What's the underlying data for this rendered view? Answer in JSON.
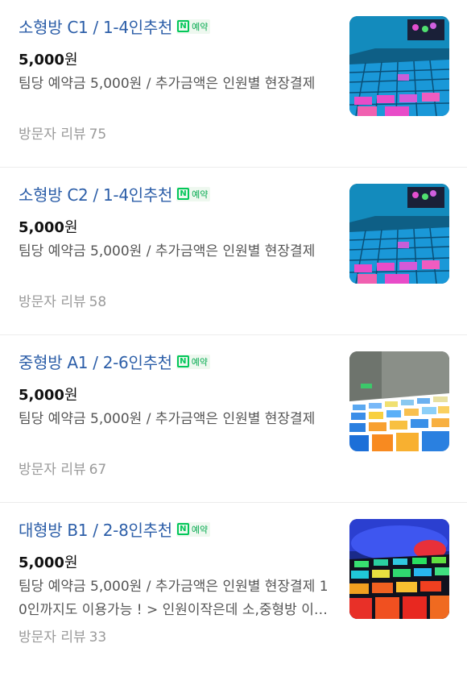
{
  "badge": {
    "letter": "N",
    "label": "예약"
  },
  "items": [
    {
      "title": "소형방 C1 / 1-4인추천",
      "price": "5,000",
      "unit": "원",
      "description": "팀당 예약금 5,000원 / 추가금액은 인원별 현장결제",
      "review_label": "방문자 리뷰",
      "review_count": "75",
      "thumbnail": "led-floor-room-small"
    },
    {
      "title": "소형방 C2 / 1-4인추천",
      "price": "5,000",
      "unit": "원",
      "description": "팀당 예약금 5,000원 / 추가금액은 인원별 현장결제",
      "review_label": "방문자 리뷰",
      "review_count": "58",
      "thumbnail": "led-floor-room-small"
    },
    {
      "title": "중형방 A1 / 2-6인추천",
      "price": "5,000",
      "unit": "원",
      "description": "팀당 예약금 5,000원 / 추가금액은 인원별 현장결제",
      "review_label": "방문자 리뷰",
      "review_count": "67",
      "thumbnail": "led-floor-room-medium"
    },
    {
      "title": "대형방 B1 / 2-8인추천",
      "price": "5,000",
      "unit": "원",
      "description": "팀당 예약금 5,000원 / 추가금액은 인원별 현장결제 10인까지도 이용가능 ! > 인원이작은데 소,중형방 이용하셔도 됩니다",
      "review_label": "방문자 리뷰",
      "review_count": "33",
      "thumbnail": "led-floor-room-large"
    }
  ],
  "colors": {
    "title": "#2c5ea8",
    "naver_green": "#03c75a",
    "review": "#9a9a9a"
  }
}
